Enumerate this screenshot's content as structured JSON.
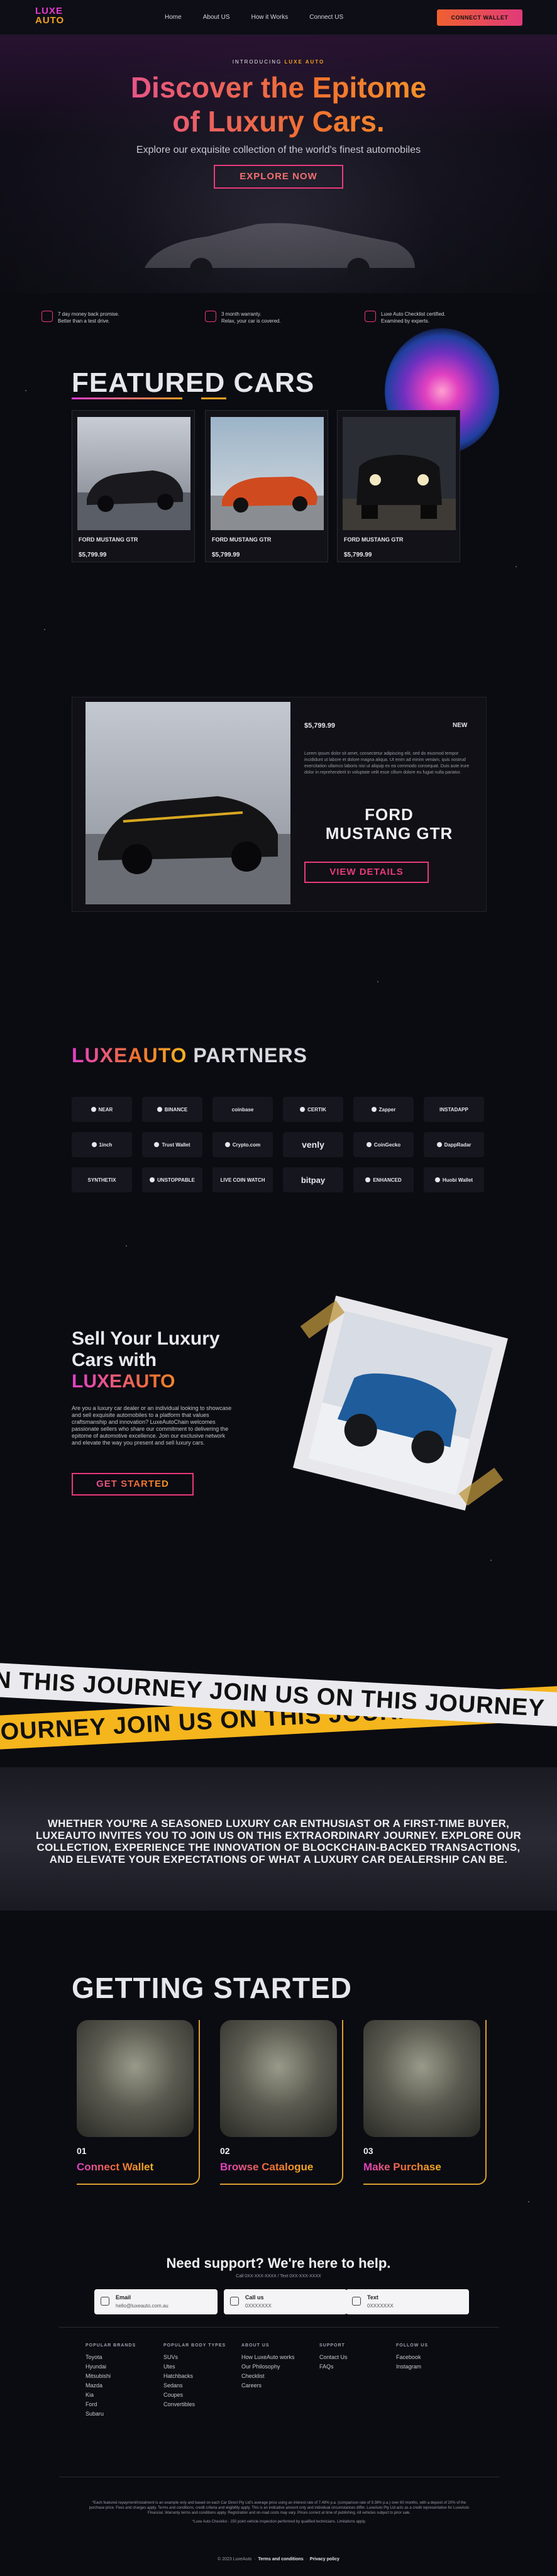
{
  "nav": {
    "logo_line1": "LUXE",
    "logo_line2": "AUTO",
    "links": [
      "Home",
      "About US",
      "How it Works",
      "Connect US"
    ],
    "connect_wallet": "CONNECT WALLET"
  },
  "hero": {
    "kicker_prefix": "INTRODUCING",
    "kicker_brand": "LUXE AUTO",
    "title_line1": "Discover the Epitome",
    "title_line2": "of Luxury Cars.",
    "subtitle": "Explore our exquisite collection of the world's finest automobiles",
    "cta": "EXPLORE NOW"
  },
  "features": [
    {
      "line1": "7 day money back promise.",
      "line2": "Better than a test drive."
    },
    {
      "line1": "3 month warranty.",
      "line2": "Relax, your car is covered."
    },
    {
      "line1": "Luxe Auto Checklist certified.",
      "line2": "Examined by experts."
    }
  ],
  "featured": {
    "title": "FEATURED CARS",
    "cars": [
      {
        "name": "FORD MUSTANG GTR",
        "price": "$5,799.99"
      },
      {
        "name": "FORD MUSTANG GTR",
        "price": "$5,799.99"
      },
      {
        "name": "FORD MUSTANG GTR",
        "price": "$5,799.99"
      }
    ]
  },
  "spotlight": {
    "price": "$5,799.99",
    "badge": "NEW",
    "description": "Lorem ipsum dolor sit amet, consectetur adipiscing elit, sed do eiusmod tempor incididunt ut labore et dolore magna aliqua. Ut enim ad minim veniam, quis nostrud exercitation ullamco laboris nisi ut aliquip ex ea commodo consequat. Duis aute irure dolor in reprehenderit in voluptate velit esse cillum dolore eu fugiat nulla pariatur.",
    "name_line1": "FORD",
    "name_line2": "MUSTANG GTR",
    "cta": "VIEW DETAILS"
  },
  "partners": {
    "title_brand": "LUXEAUTO",
    "title_rest": "PARTNERS",
    "row1": [
      "NEAR",
      "BINANCE",
      "coinbase",
      "CERTIK",
      "Zapper",
      "INSTADAPP"
    ],
    "row2": [
      "1inch",
      "Trust Wallet",
      "Crypto.com",
      "venly",
      "CoinGecko",
      "DappRadar"
    ],
    "row3": [
      "SYNTHETIX",
      "UNSTOPPABLE",
      "LIVE COIN WATCH",
      "bitpay",
      "ENHANCED",
      "Huobi Wallet"
    ]
  },
  "sell": {
    "title_line1": "Sell Your Luxury",
    "title_line2": "Cars with",
    "title_brand": "LUXEAUTO",
    "body": "Are you a luxury car dealer or an individual looking to showcase and sell exquisite automobiles to a platform that values craftsmanship and innovation? LuxeAutoChain welcomes passionate sellers who share our commitment to delivering the epitome of automotive excellence. Join our exclusive network and elevate the way you present and sell luxury cars.",
    "cta": "GET STARTED"
  },
  "banners": {
    "white": "IN THIS JOURNEY   JOIN US ON THIS JOURNEY",
    "yellow": "JOURNEY   JOIN US ON THIS JOURNEY   JOIN US ON THIS JOURNEY   JOIN"
  },
  "enthusiast": "WHETHER YOU'RE A SEASONED LUXURY CAR ENTHUSIAST OR A FIRST-TIME BUYER, LUXEAUTO INVITES YOU TO JOIN US ON THIS EXTRAORDINARY JOURNEY. EXPLORE OUR COLLECTION, EXPERIENCE THE INNOVATION OF BLOCKCHAIN-BACKED TRANSACTIONS, AND ELEVATE YOUR EXPECTATIONS OF WHAT A LUXURY CAR DEALERSHIP CAN BE.",
  "getting_started": {
    "title": "GETTING STARTED",
    "steps": [
      {
        "num": "01",
        "label": "Connect Wallet"
      },
      {
        "num": "02",
        "label": "Browse Catalogue"
      },
      {
        "num": "03",
        "label": "Make Purchase"
      }
    ]
  },
  "support": {
    "title": "Need support? We're here to help.",
    "subtitle": "Call 0XX-XXX-XXXX / Text 0XX-XXX-XXXX",
    "contacts": [
      {
        "type": "Email",
        "value": "hello@luxeauto.com.au"
      },
      {
        "type": "Call us",
        "value": "0XXXXXXX"
      },
      {
        "type": "Text",
        "value": "0XXXXXXX"
      }
    ]
  },
  "footer": {
    "columns": [
      {
        "heading": "POPULAR BRANDS",
        "items": [
          "Toyota",
          "Hyundai",
          "Mitsubishi",
          "Mazda",
          "Kia",
          "Ford",
          "Subaru"
        ]
      },
      {
        "heading": "POPULAR BODY TYPES",
        "items": [
          "SUVs",
          "Utes",
          "Hatchbacks",
          "Sedans",
          "Coupes",
          "Convertibles"
        ]
      },
      {
        "heading": "ABOUT US",
        "items": [
          "How LuxeAuto works",
          "Our Philosophy",
          "Checklist",
          "Careers"
        ]
      },
      {
        "heading": "SUPPORT",
        "items": [
          "Contact Us",
          "FAQs"
        ]
      },
      {
        "heading": "FOLLOW US",
        "items": [
          "Facebook",
          "Instagram"
        ]
      }
    ],
    "disclaimer": "*Each featured repayment/instalment is an example only and based on each Car Direct Pty Ltd's average price using an interest rate of 7.49% p.a. (comparison rate of 9.38% p.a.) over 60 months, with a deposit of 20% of the purchase price. Fees and charges apply. Terms and conditions, credit criteria and eligibility apply. This is an indicative amount only and individual circumstances differ. LuxeAuto Pty Ltd acts as a credit representative for LuxeAuto Financial. Warranty terms and conditions apply. Registration and on-road costs may vary. Prices correct at time of publishing. All vehicles subject to prior sale.",
    "disclaimer2": "*Luxe Auto Checklist - 150 point vehicle inspection performed by qualified technicians. Limitations apply.",
    "copyright": "© 2023 LuxeAuto",
    "terms": "Terms and conditions",
    "privacy": "Privacy policy"
  },
  "colors": {
    "magenta": "#e83ad0",
    "orange": "#f07030",
    "gold": "#f3a11f",
    "bg": "#0b0b12"
  }
}
